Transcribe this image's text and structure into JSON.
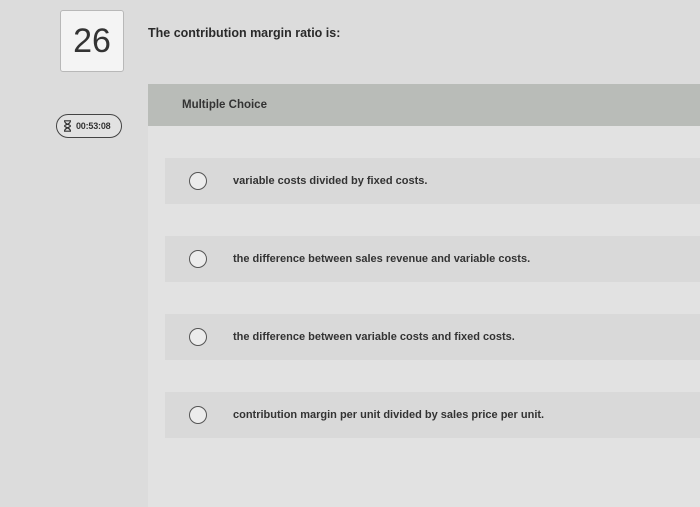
{
  "question": {
    "number": "26",
    "text": "The contribution margin ratio is:"
  },
  "timer": {
    "value": "00:53:08",
    "icon": "hourglass-icon"
  },
  "multiple_choice": {
    "header": "Multiple Choice",
    "options": [
      {
        "label": "variable costs divided by fixed costs."
      },
      {
        "label": "the difference between sales revenue and variable costs."
      },
      {
        "label": "the difference between variable costs and fixed costs."
      },
      {
        "label": "contribution margin per unit divided by sales price per unit."
      }
    ]
  }
}
